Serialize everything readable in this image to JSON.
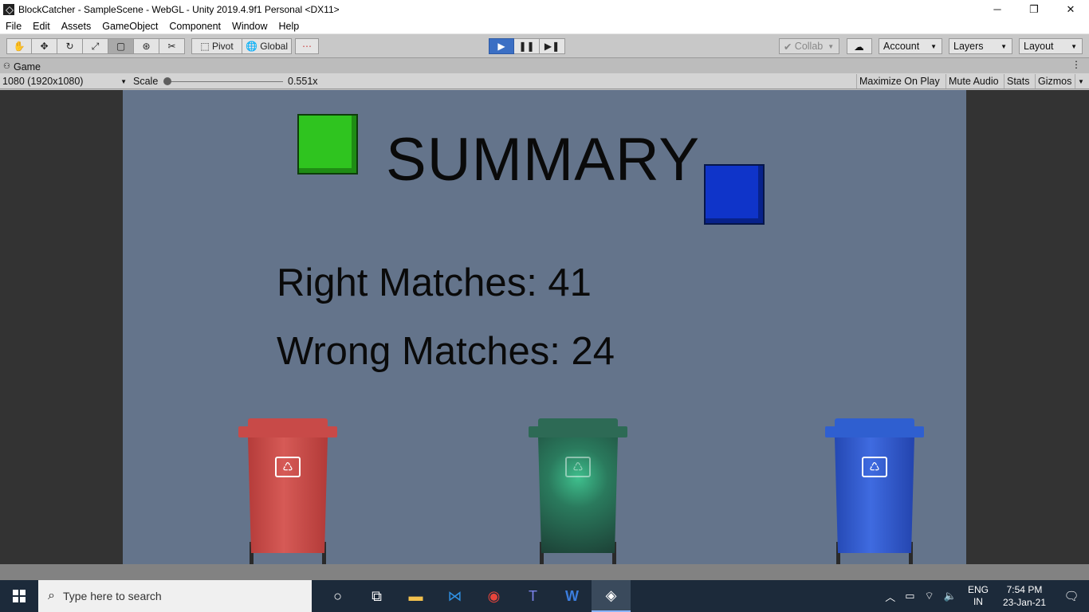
{
  "window": {
    "title": "BlockCatcher - SampleScene - WebGL - Unity 2019.4.9f1 Personal <DX11>",
    "controls": [
      "─",
      "❐",
      "✕"
    ]
  },
  "menu": [
    "File",
    "Edit",
    "Assets",
    "GameObject",
    "Component",
    "Window",
    "Help"
  ],
  "toolbar": {
    "pivot": "Pivot",
    "global": "Global",
    "collab": "Collab",
    "account": "Account",
    "layers": "Layers",
    "layout": "Layout"
  },
  "game_tab": {
    "label": "Game",
    "resolution": "1080 (1920x1080)",
    "scale_label": "Scale",
    "scale_value": "0.551x",
    "maximize_on_play": "Maximize On Play",
    "mute_audio": "Mute Audio",
    "stats": "Stats",
    "gizmos": "Gizmos"
  },
  "game": {
    "heading": "SUMMARY",
    "right_matches": "Right Matches: 41",
    "wrong_matches": "Wrong Matches: 24",
    "colors": {
      "background": "#64748b",
      "green_block": "#2fc41f",
      "blue_block": "#0f34c9"
    }
  },
  "taskbar": {
    "search_placeholder": "Type here to search",
    "lang_top": "ENG",
    "lang_bottom": "IN",
    "time": "7:54 PM",
    "date": "23-Jan-21",
    "pinned_icons": [
      "cortana-icon",
      "task-view-icon",
      "file-explorer-icon",
      "vscode-icon",
      "chrome-icon",
      "teams-icon",
      "word-icon",
      "unity-icon"
    ]
  }
}
